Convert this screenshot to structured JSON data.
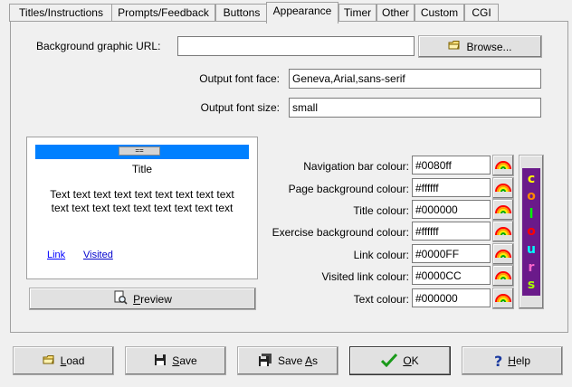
{
  "tabs": [
    {
      "label": "Titles/Instructions"
    },
    {
      "label": "Prompts/Feedback"
    },
    {
      "label": "Buttons"
    },
    {
      "label": "Appearance"
    },
    {
      "label": "Timer"
    },
    {
      "label": "Other"
    },
    {
      "label": "Custom"
    },
    {
      "label": "CGI"
    }
  ],
  "background": {
    "label": "Background graphic URL:",
    "value": "",
    "browse_label": "Browse..."
  },
  "font": {
    "face_label": "Output font face:",
    "face_value": "Geneva,Arial,sans-serif",
    "size_label": "Output font size:",
    "size_value": "small"
  },
  "preview": {
    "nav_button": "==",
    "title": "Title",
    "text": "Text text text text text text text text text text text text text text text text text text",
    "link": "Link",
    "visited": "Visited",
    "button_label": "Preview",
    "nav_color": "#0080ff",
    "link_color": "#0000FF",
    "visited_color": "#0000CC"
  },
  "colours": [
    {
      "label": "Navigation bar colour:",
      "value": "#0080ff"
    },
    {
      "label": "Page background colour:",
      "value": "#ffffff"
    },
    {
      "label": "Title colour:",
      "value": "#000000"
    },
    {
      "label": "Exercise background colour:",
      "value": "#ffffff"
    },
    {
      "label": "Link colour:",
      "value": "#0000FF"
    },
    {
      "label": "Visited link colour:",
      "value": "#0000CC"
    },
    {
      "label": "Text colour:",
      "value": "#000000"
    }
  ],
  "colours_button": {
    "letters": [
      "c",
      "o",
      "l",
      "o",
      "u",
      "r",
      "s"
    ],
    "letter_colors": [
      "#ffff00",
      "#ff8800",
      "#00ff00",
      "#ff0000",
      "#00ffff",
      "#ff66cc",
      "#aaff00"
    ]
  },
  "footer": {
    "load": "Load",
    "save": "Save",
    "save_as": "Save As",
    "ok": "OK",
    "help": "Help"
  }
}
